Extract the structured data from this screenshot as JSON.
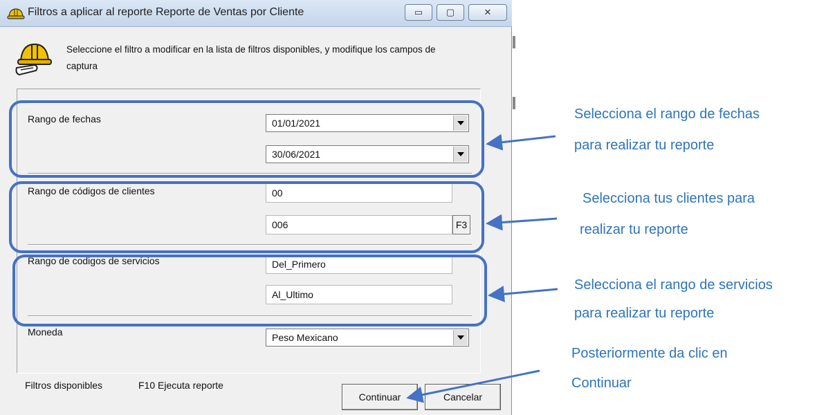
{
  "window": {
    "title": "Filtros a aplicar al reporte Reporte de Ventas por Cliente",
    "minimize_label": "▭",
    "maximize_label": "▢",
    "close_label": "✕"
  },
  "header": {
    "text": "Seleccione el filtro a modificar  en la lista de filtros disponibles, y modifique los campos de  captura"
  },
  "filters": {
    "fechas": {
      "label": "Rango de fechas",
      "from": "01/01/2021",
      "to": "30/06/2021"
    },
    "clientes": {
      "label": "Rango de códigos de clientes",
      "from": "00",
      "to": "006",
      "lookup_key": "F3"
    },
    "servicios": {
      "label": "Rango de codigos de servicios",
      "from": "Del_Primero",
      "to": "Al_Ultimo"
    },
    "moneda": {
      "label": "Moneda",
      "value": "Peso Mexicano"
    }
  },
  "footer": {
    "available": "Filtros disponibles",
    "hint": "F10 Ejecuta reporte",
    "continue_label": "Continuar",
    "cancel_label": "Cancelar"
  },
  "annotations": {
    "fechas_line1": "Selecciona el rango de fechas",
    "fechas_line2": "para realizar tu reporte",
    "clientes_line1": "Selecciona tus clientes para",
    "clientes_line2": "realizar tu reporte",
    "servicios_line1": "Selecciona el rango de servicios",
    "servicios_line2": "para realizar tu reporte",
    "continuar_line1": "Posteriormente da clic en",
    "continuar_line2": "Continuar"
  },
  "colors": {
    "annotation_blue": "#2e75b6",
    "highlight_blue": "#4472c4",
    "window_bg": "#f0f0f0"
  },
  "icons": {
    "title": "hardhat-icon",
    "header": "hardhat-scroll-icon",
    "combo_arrow": "dropdown-arrow-icon"
  }
}
